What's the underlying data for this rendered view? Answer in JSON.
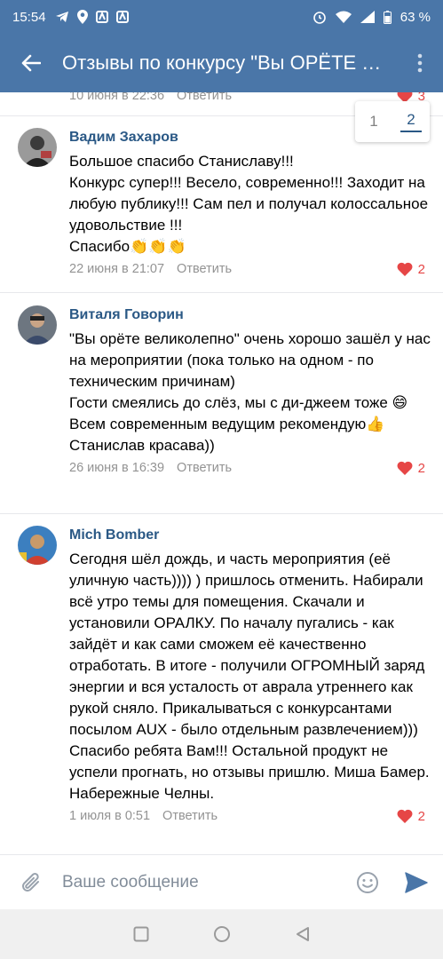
{
  "status": {
    "time": "15:54",
    "battery": "63 %"
  },
  "header": {
    "title": "Отзывы по конкурсу \"Вы ОРЁТЕ ВЕЛИКОЛЕПНО\""
  },
  "partial": {
    "date": "10 июня в 22:36",
    "reply": "Ответить",
    "likes": "3"
  },
  "pager": {
    "pages": [
      "1",
      "2"
    ],
    "active": "2"
  },
  "comments": [
    {
      "author": "Вадим Захаров",
      "text": "Большое спасибо Станиславу!!!\nКонкурс супер!!! Весело, современно!!! Заходит на любую публику!!! Сам пел и получал колоссальное удовольствие !!!\nСпасибо👏👏👏",
      "date": "22 июня в 21:07",
      "reply": "Ответить",
      "likes": "2"
    },
    {
      "author": "Виталя Говорин",
      "text": "\"Вы орёте великолепно\" очень хорошо зашёл у нас на мероприятии (пока только на одном - по техническим причинам)\nГости смеялись до слёз, мы с ди-джеем тоже 😄\nВсем современным ведущим рекомендую👍\nСтанислав красава))",
      "date": "26 июня в 16:39",
      "reply": "Ответить",
      "likes": "2"
    },
    {
      "author": "Mich Bomber",
      "text": "Сегодня шёл дождь, и часть мероприятия (её уличную часть)))) ) пришлось отменить. Набирали всё утро темы для помещения. Скачали и установили ОРАЛКУ. По началу пугались - как зайдёт и как сами сможем её качественно отработать. В итоге - получили ОГРОМНЫЙ заряд энергии и вся усталость от аврала утреннего как рукой сняло. Прикалываться с конкурсантами посылом AUX - было отдельным развлечением))) Спасибо ребята Вам!!! Остальной продукт не успели прогнать, но отзывы пришлю. Миша Бамер. Набережные Челны.",
      "date": "1 июля в 0:51",
      "reply": "Ответить",
      "likes": "2"
    }
  ],
  "composer": {
    "placeholder": "Ваше сообщение"
  },
  "colors": {
    "header": "#4a76a8",
    "link": "#2a5885",
    "like": "#e64646",
    "meta": "#939393"
  }
}
